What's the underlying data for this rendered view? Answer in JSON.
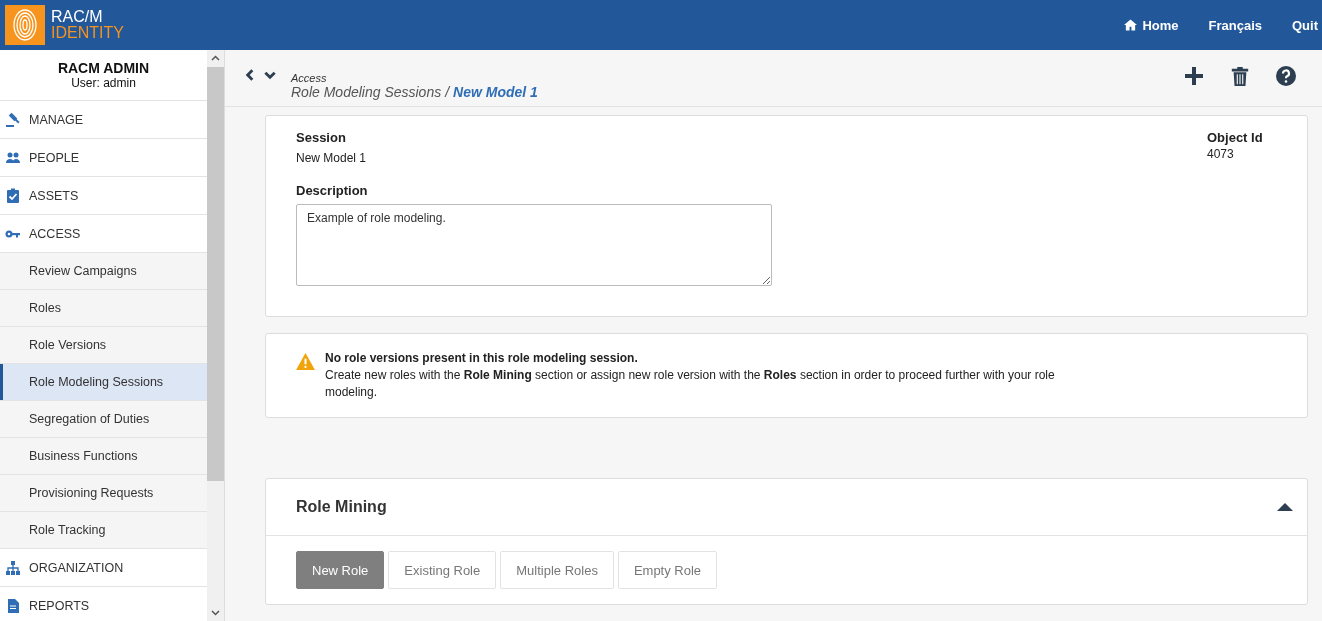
{
  "header": {
    "logo_top": "RAC/M",
    "logo_bottom": "IDENTITY",
    "links": [
      {
        "label": "Home"
      },
      {
        "label": "Français"
      },
      {
        "label": "Quit"
      }
    ]
  },
  "sidebar": {
    "account": "RACM ADMIN",
    "user": "User: admin",
    "items": [
      {
        "label": "MANAGE",
        "selected": false
      },
      {
        "label": "PEOPLE",
        "selected": false
      },
      {
        "label": "ASSETS",
        "selected": false
      },
      {
        "label": "ACCESS",
        "selected": false,
        "children": [
          {
            "label": "Review Campaigns",
            "selected": false
          },
          {
            "label": "Roles",
            "selected": false
          },
          {
            "label": "Role Versions",
            "selected": false
          },
          {
            "label": "Role Modeling Sessions",
            "selected": true
          },
          {
            "label": "Segregation of Duties",
            "selected": false
          },
          {
            "label": "Business Functions",
            "selected": false
          },
          {
            "label": "Provisioning Requests",
            "selected": false
          },
          {
            "label": "Role Tracking",
            "selected": false
          }
        ]
      },
      {
        "label": "ORGANIZATION",
        "selected": false
      },
      {
        "label": "REPORTS",
        "selected": false
      }
    ]
  },
  "breadcrumb": {
    "section": "Access",
    "parent": "Role Modeling Sessions",
    "separator": "/",
    "current": "New Model 1"
  },
  "session_card": {
    "session_label": "Session",
    "session_value": "New Model 1",
    "object_id_label": "Object Id",
    "object_id_value": "4073",
    "description_label": "Description",
    "description_value": "Example of role modeling."
  },
  "warning": {
    "title": "No role versions present in this role modeling session.",
    "message": "Create new roles with the **Role Mining** section or assign new role version with the **Roles** section in order to proceed further with your role modeling."
  },
  "role_mining": {
    "title": "Role Mining",
    "expanded": true,
    "tabs": [
      {
        "label": "New Role",
        "selected": true
      },
      {
        "label": "Existing Role",
        "selected": false
      },
      {
        "label": "Multiple Roles",
        "selected": false
      },
      {
        "label": "Empty Role",
        "selected": false
      }
    ]
  }
}
